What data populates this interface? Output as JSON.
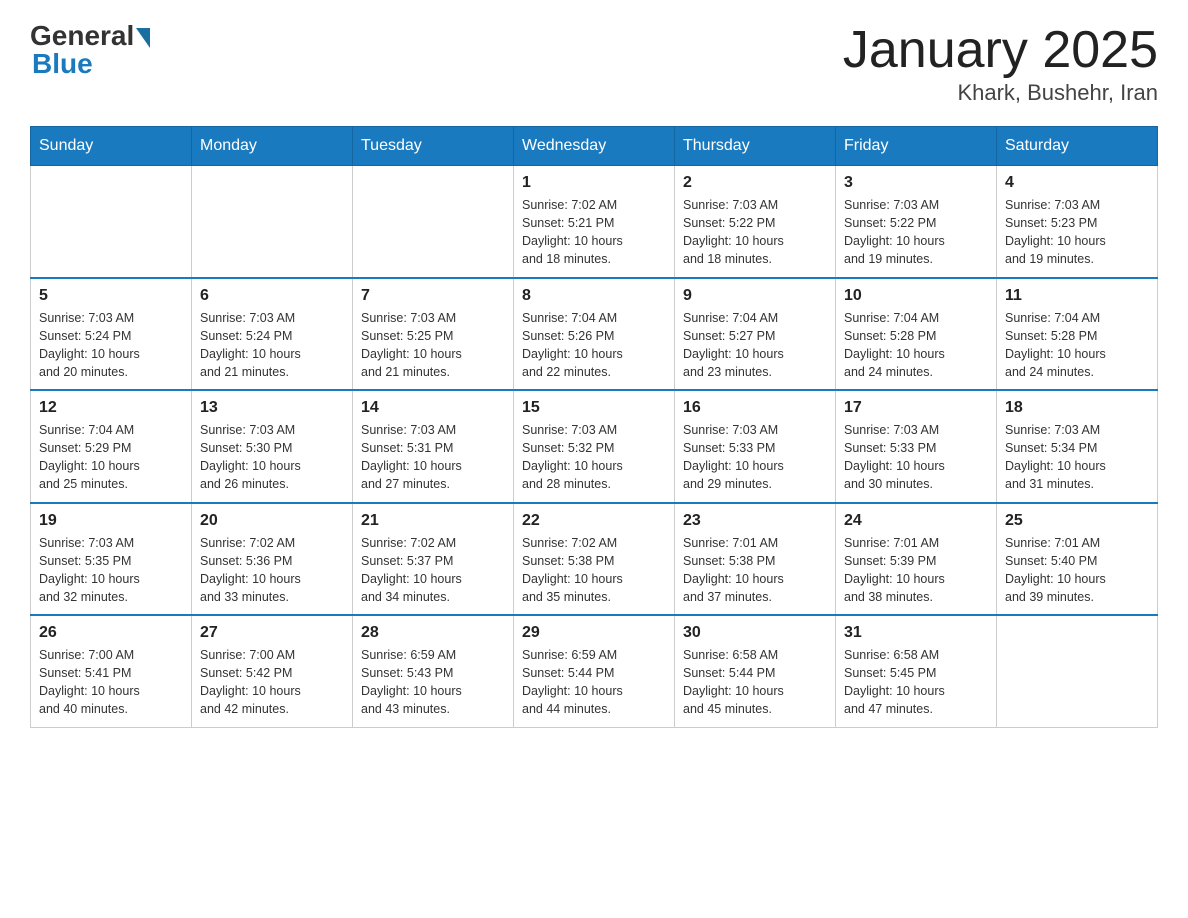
{
  "header": {
    "logo_general": "General",
    "logo_blue": "Blue",
    "title": "January 2025",
    "subtitle": "Khark, Bushehr, Iran"
  },
  "weekdays": [
    "Sunday",
    "Monday",
    "Tuesday",
    "Wednesday",
    "Thursday",
    "Friday",
    "Saturday"
  ],
  "weeks": [
    [
      {
        "day": "",
        "info": ""
      },
      {
        "day": "",
        "info": ""
      },
      {
        "day": "",
        "info": ""
      },
      {
        "day": "1",
        "info": "Sunrise: 7:02 AM\nSunset: 5:21 PM\nDaylight: 10 hours\nand 18 minutes."
      },
      {
        "day": "2",
        "info": "Sunrise: 7:03 AM\nSunset: 5:22 PM\nDaylight: 10 hours\nand 18 minutes."
      },
      {
        "day": "3",
        "info": "Sunrise: 7:03 AM\nSunset: 5:22 PM\nDaylight: 10 hours\nand 19 minutes."
      },
      {
        "day": "4",
        "info": "Sunrise: 7:03 AM\nSunset: 5:23 PM\nDaylight: 10 hours\nand 19 minutes."
      }
    ],
    [
      {
        "day": "5",
        "info": "Sunrise: 7:03 AM\nSunset: 5:24 PM\nDaylight: 10 hours\nand 20 minutes."
      },
      {
        "day": "6",
        "info": "Sunrise: 7:03 AM\nSunset: 5:24 PM\nDaylight: 10 hours\nand 21 minutes."
      },
      {
        "day": "7",
        "info": "Sunrise: 7:03 AM\nSunset: 5:25 PM\nDaylight: 10 hours\nand 21 minutes."
      },
      {
        "day": "8",
        "info": "Sunrise: 7:04 AM\nSunset: 5:26 PM\nDaylight: 10 hours\nand 22 minutes."
      },
      {
        "day": "9",
        "info": "Sunrise: 7:04 AM\nSunset: 5:27 PM\nDaylight: 10 hours\nand 23 minutes."
      },
      {
        "day": "10",
        "info": "Sunrise: 7:04 AM\nSunset: 5:28 PM\nDaylight: 10 hours\nand 24 minutes."
      },
      {
        "day": "11",
        "info": "Sunrise: 7:04 AM\nSunset: 5:28 PM\nDaylight: 10 hours\nand 24 minutes."
      }
    ],
    [
      {
        "day": "12",
        "info": "Sunrise: 7:04 AM\nSunset: 5:29 PM\nDaylight: 10 hours\nand 25 minutes."
      },
      {
        "day": "13",
        "info": "Sunrise: 7:03 AM\nSunset: 5:30 PM\nDaylight: 10 hours\nand 26 minutes."
      },
      {
        "day": "14",
        "info": "Sunrise: 7:03 AM\nSunset: 5:31 PM\nDaylight: 10 hours\nand 27 minutes."
      },
      {
        "day": "15",
        "info": "Sunrise: 7:03 AM\nSunset: 5:32 PM\nDaylight: 10 hours\nand 28 minutes."
      },
      {
        "day": "16",
        "info": "Sunrise: 7:03 AM\nSunset: 5:33 PM\nDaylight: 10 hours\nand 29 minutes."
      },
      {
        "day": "17",
        "info": "Sunrise: 7:03 AM\nSunset: 5:33 PM\nDaylight: 10 hours\nand 30 minutes."
      },
      {
        "day": "18",
        "info": "Sunrise: 7:03 AM\nSunset: 5:34 PM\nDaylight: 10 hours\nand 31 minutes."
      }
    ],
    [
      {
        "day": "19",
        "info": "Sunrise: 7:03 AM\nSunset: 5:35 PM\nDaylight: 10 hours\nand 32 minutes."
      },
      {
        "day": "20",
        "info": "Sunrise: 7:02 AM\nSunset: 5:36 PM\nDaylight: 10 hours\nand 33 minutes."
      },
      {
        "day": "21",
        "info": "Sunrise: 7:02 AM\nSunset: 5:37 PM\nDaylight: 10 hours\nand 34 minutes."
      },
      {
        "day": "22",
        "info": "Sunrise: 7:02 AM\nSunset: 5:38 PM\nDaylight: 10 hours\nand 35 minutes."
      },
      {
        "day": "23",
        "info": "Sunrise: 7:01 AM\nSunset: 5:38 PM\nDaylight: 10 hours\nand 37 minutes."
      },
      {
        "day": "24",
        "info": "Sunrise: 7:01 AM\nSunset: 5:39 PM\nDaylight: 10 hours\nand 38 minutes."
      },
      {
        "day": "25",
        "info": "Sunrise: 7:01 AM\nSunset: 5:40 PM\nDaylight: 10 hours\nand 39 minutes."
      }
    ],
    [
      {
        "day": "26",
        "info": "Sunrise: 7:00 AM\nSunset: 5:41 PM\nDaylight: 10 hours\nand 40 minutes."
      },
      {
        "day": "27",
        "info": "Sunrise: 7:00 AM\nSunset: 5:42 PM\nDaylight: 10 hours\nand 42 minutes."
      },
      {
        "day": "28",
        "info": "Sunrise: 6:59 AM\nSunset: 5:43 PM\nDaylight: 10 hours\nand 43 minutes."
      },
      {
        "day": "29",
        "info": "Sunrise: 6:59 AM\nSunset: 5:44 PM\nDaylight: 10 hours\nand 44 minutes."
      },
      {
        "day": "30",
        "info": "Sunrise: 6:58 AM\nSunset: 5:44 PM\nDaylight: 10 hours\nand 45 minutes."
      },
      {
        "day": "31",
        "info": "Sunrise: 6:58 AM\nSunset: 5:45 PM\nDaylight: 10 hours\nand 47 minutes."
      },
      {
        "day": "",
        "info": ""
      }
    ]
  ]
}
